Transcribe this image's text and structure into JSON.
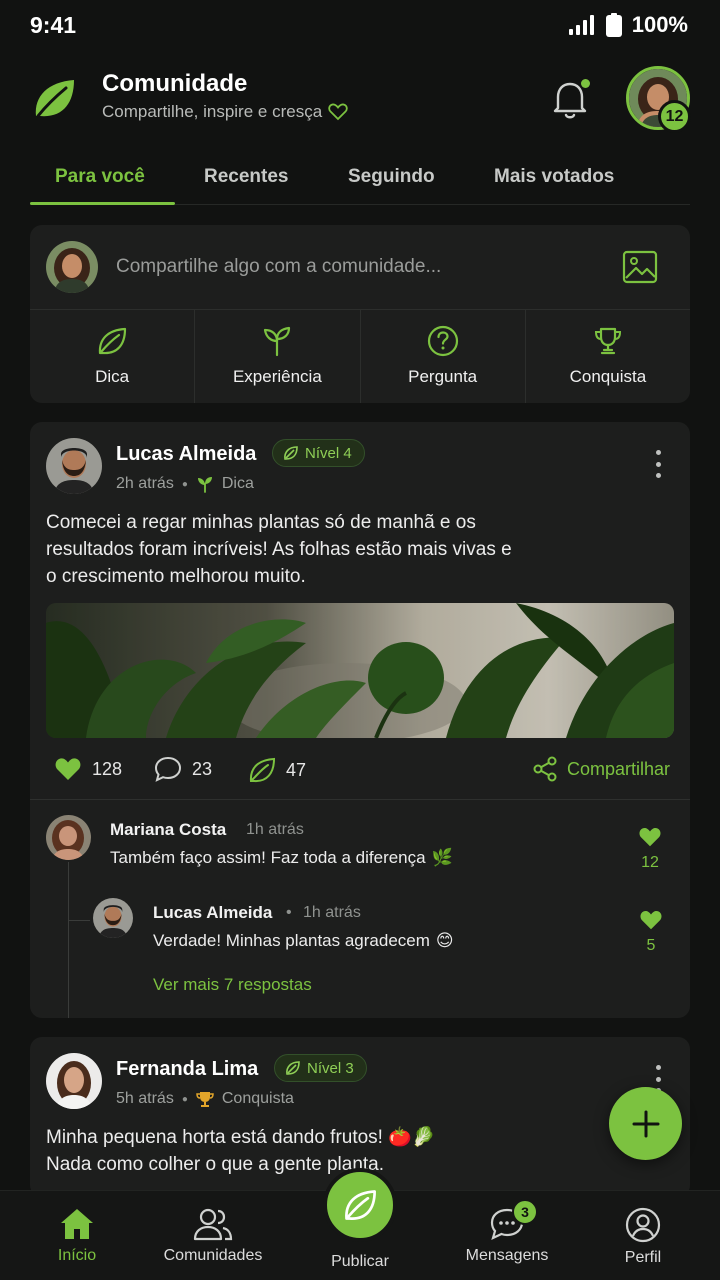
{
  "status_bar": {
    "time": "9:41",
    "battery": "100%"
  },
  "header": {
    "title": "Comunidade",
    "subtitle": "Compartilhe, inspire e cresça",
    "avatar_badge": "12"
  },
  "tabs": [
    "Para você",
    "Recentes",
    "Seguindo",
    "Mais votados"
  ],
  "composer": {
    "placeholder": "Compartilhe algo com a comunidade...",
    "actions": [
      {
        "label": "Dica",
        "icon": "leaf-icon"
      },
      {
        "label": "Experiência",
        "icon": "sprout-icon"
      },
      {
        "label": "Pergunta",
        "icon": "question-icon"
      },
      {
        "label": "Conquista",
        "icon": "trophy-icon"
      }
    ]
  },
  "post1": {
    "author": "Lucas Almeida",
    "level": "Nível 4",
    "time": "2h atrás",
    "category": "Dica",
    "text": "Comecei a regar minhas plantas só de manhã e os resultados foram incríveis! As folhas estão mais vivas e o crescimento melhorou muito.",
    "likes": "128",
    "comments": "23",
    "leaves": "47",
    "share_label": "Compartilhar",
    "comment1": {
      "author": "Mariana Costa",
      "time": "1h atrás",
      "text": "Também faço assim! Faz toda a diferença",
      "emoji": "🌿",
      "likes": "12"
    },
    "reply1": {
      "author": "Lucas Almeida",
      "separator": "•",
      "time": "1h atrás",
      "text": "Verdade! Minhas plantas agradecem",
      "emoji": "😊",
      "likes": "5"
    },
    "more_replies": "Ver mais 7 respostas"
  },
  "post2": {
    "author": "Fernanda Lima",
    "level": "Nível 3",
    "time": "5h atrás",
    "category": "Conquista",
    "text_line1": "Minha pequena horta está dando frutos! 🍅🥬",
    "text_line2": "Nada como colher o que a gente planta."
  },
  "bottom_nav": {
    "items": [
      "Início",
      "Comunidades",
      "Publicar",
      "Mensagens",
      "Perfil"
    ],
    "messages_badge": "3"
  },
  "colors": {
    "accent": "#7cc240",
    "background": "#111211",
    "card": "#1d1e1d"
  }
}
